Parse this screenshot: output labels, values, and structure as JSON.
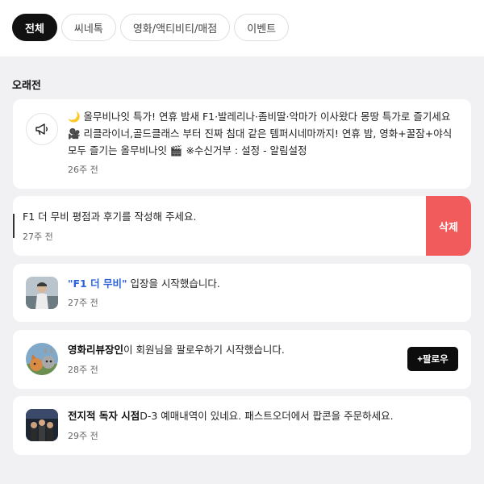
{
  "tabs": [
    {
      "label": "전체",
      "active": true
    },
    {
      "label": "씨네톡",
      "active": false
    },
    {
      "label": "영화/액티비티/매점",
      "active": false
    },
    {
      "label": "이벤트",
      "active": false
    }
  ],
  "section_title": "오래전",
  "notifications": [
    {
      "icon": "megaphone-icon",
      "line1": "🌙 올무비나잇 특가! 연휴 밤새 F1·발레리나·좀비딸·악마가 이사왔다 몽땅 특가로 즐기세요",
      "line2": "🎥 리클라이너,골드클래스 부터 진짜 침대 같은 템퍼시네마까지! 연휴 밤, 영화+꿀잠+야식",
      "line3": "모두 즐기는 올무비나잇 🎬 ※수신거부 : 설정 - 알림설정",
      "time": "26주 전"
    },
    {
      "text": "F1 더 무비 평점과 후기를 작성해 주세요.",
      "time": "27주 전",
      "delete_label": "삭제"
    },
    {
      "highlight": "\"F1 더 무비\"",
      "rest": " 입장을 시작했습니다.",
      "time": "27주 전",
      "thumb": "movie-poster"
    },
    {
      "highlight": "영화리뷰장인",
      "rest": "이 회원님을 팔로우하기 시작했습니다.",
      "time": "28주 전",
      "follow_label": "+팔로우",
      "thumb": "profile-avatar"
    },
    {
      "highlight": "전지적 독자 시점",
      "rest": "D-3 예매내역이 있네요. 패스트오더에서 팝콘을 주문하세요.",
      "time": "29주 전",
      "thumb": "movie-poster"
    }
  ],
  "colors": {
    "background": "#f1f1f3",
    "delete": "#f25b5b",
    "link_blue": "#2b63d9",
    "active_tab": "#111111"
  }
}
